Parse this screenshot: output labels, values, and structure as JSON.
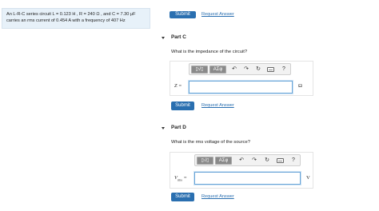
{
  "problem": {
    "text": "An L-R-C series circuit L = 0.123 H , R = 240 Ω , and C = 7.30 μF carries an rms current of 0.454 A with a frequency of 407 Hz",
    "dot": "."
  },
  "top_actions": {
    "submit": "Submit",
    "request": "Request Answer"
  },
  "part_c": {
    "title": "Part C",
    "question": "What is the impedance of the circuit?",
    "label": "Z =",
    "value": "",
    "unit": "Ω",
    "submit": "Submit",
    "request": "Request Answer"
  },
  "part_d": {
    "title": "Part D",
    "question": "What is the rms voltage of the source?",
    "label": "V",
    "label_sub": "rms",
    "label_eq": "=",
    "value": "",
    "unit": "V",
    "submit": "Submit",
    "request": "Request Answer"
  },
  "toolbar": {
    "templates_label": "▯√▯",
    "symbols_label": "ΑΣφ",
    "undo": "↶",
    "redo": "↷",
    "reset": "↻",
    "help": "?"
  }
}
